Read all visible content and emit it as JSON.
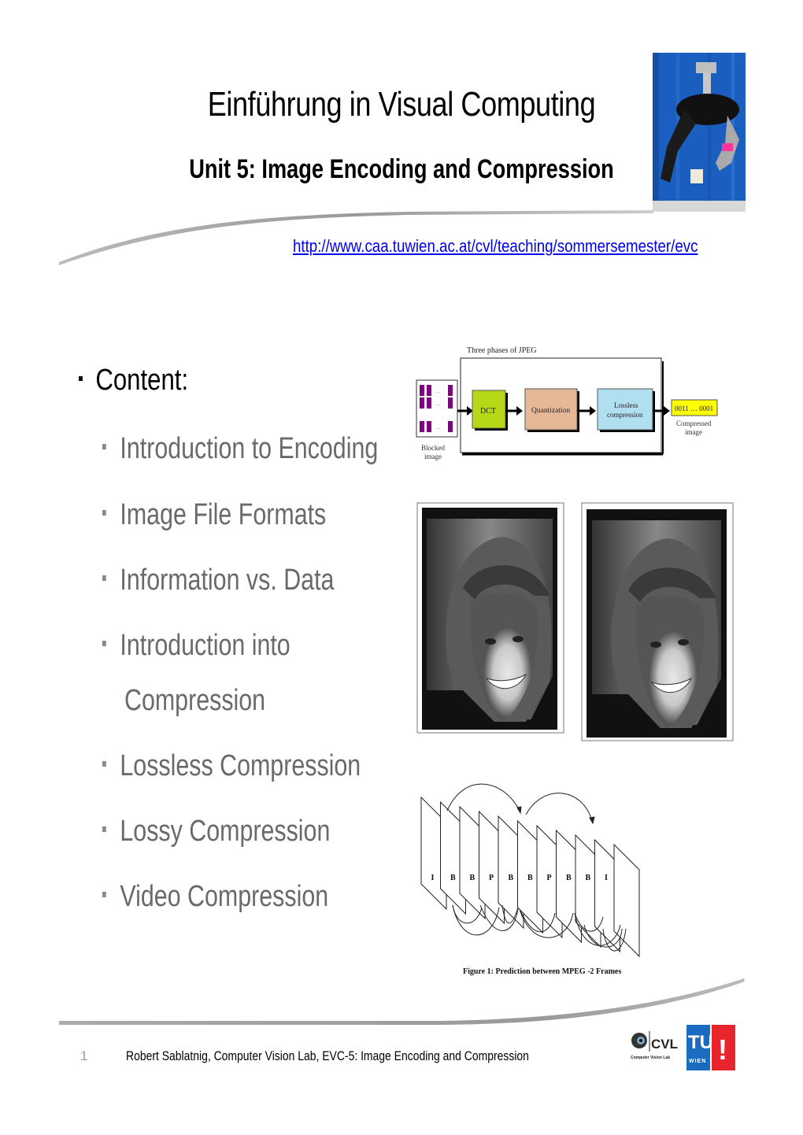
{
  "slide": {
    "title": "Einführung in Visual Computing",
    "subtitle": "Unit 5: Image Encoding and Compression",
    "url": "http://www.caa.tuwien.ac.at/cvl/teaching/sommersemester/evc",
    "bullets": {
      "main": "Content:",
      "items": [
        "Introduction to Encoding",
        "Image File Formats",
        "Information vs. Data",
        "Introduction into",
        "Compression",
        "Lossless Compression",
        "Lossy Compression",
        "Video Compression"
      ]
    },
    "jpeg_diagram": {
      "title": "Three phases of JPEG",
      "input_label_1": "Blocked",
      "input_label_2": "image",
      "stages": [
        "DCT",
        "Quantization",
        "Lossless",
        "compression"
      ],
      "output_value": "0011 … 0001",
      "output_label_1": "Compressed",
      "output_label_2": "image",
      "colors": {
        "dct": "#b5d916",
        "quant": "#e6b896",
        "lossless": "#b0dff0",
        "output": "#ffff00",
        "block": "#800080"
      }
    },
    "mpeg_diagram": {
      "frames": [
        "I",
        "B",
        "B",
        "P",
        "B",
        "B",
        "P",
        "B",
        "B",
        "I"
      ],
      "caption": "Figure 1: Prediction between MPEG -2 Frames"
    },
    "footer": {
      "page_number": "1",
      "text": "Robert Sablatnig, Computer Vision Lab, EVC-5: Image Encoding and Compression",
      "logo_cvl": "CVL",
      "logo_cvl_sub": "Computer Vision Lab",
      "logo_tu": "TU",
      "logo_wien": "WIEN",
      "logo_excl": "!"
    }
  }
}
